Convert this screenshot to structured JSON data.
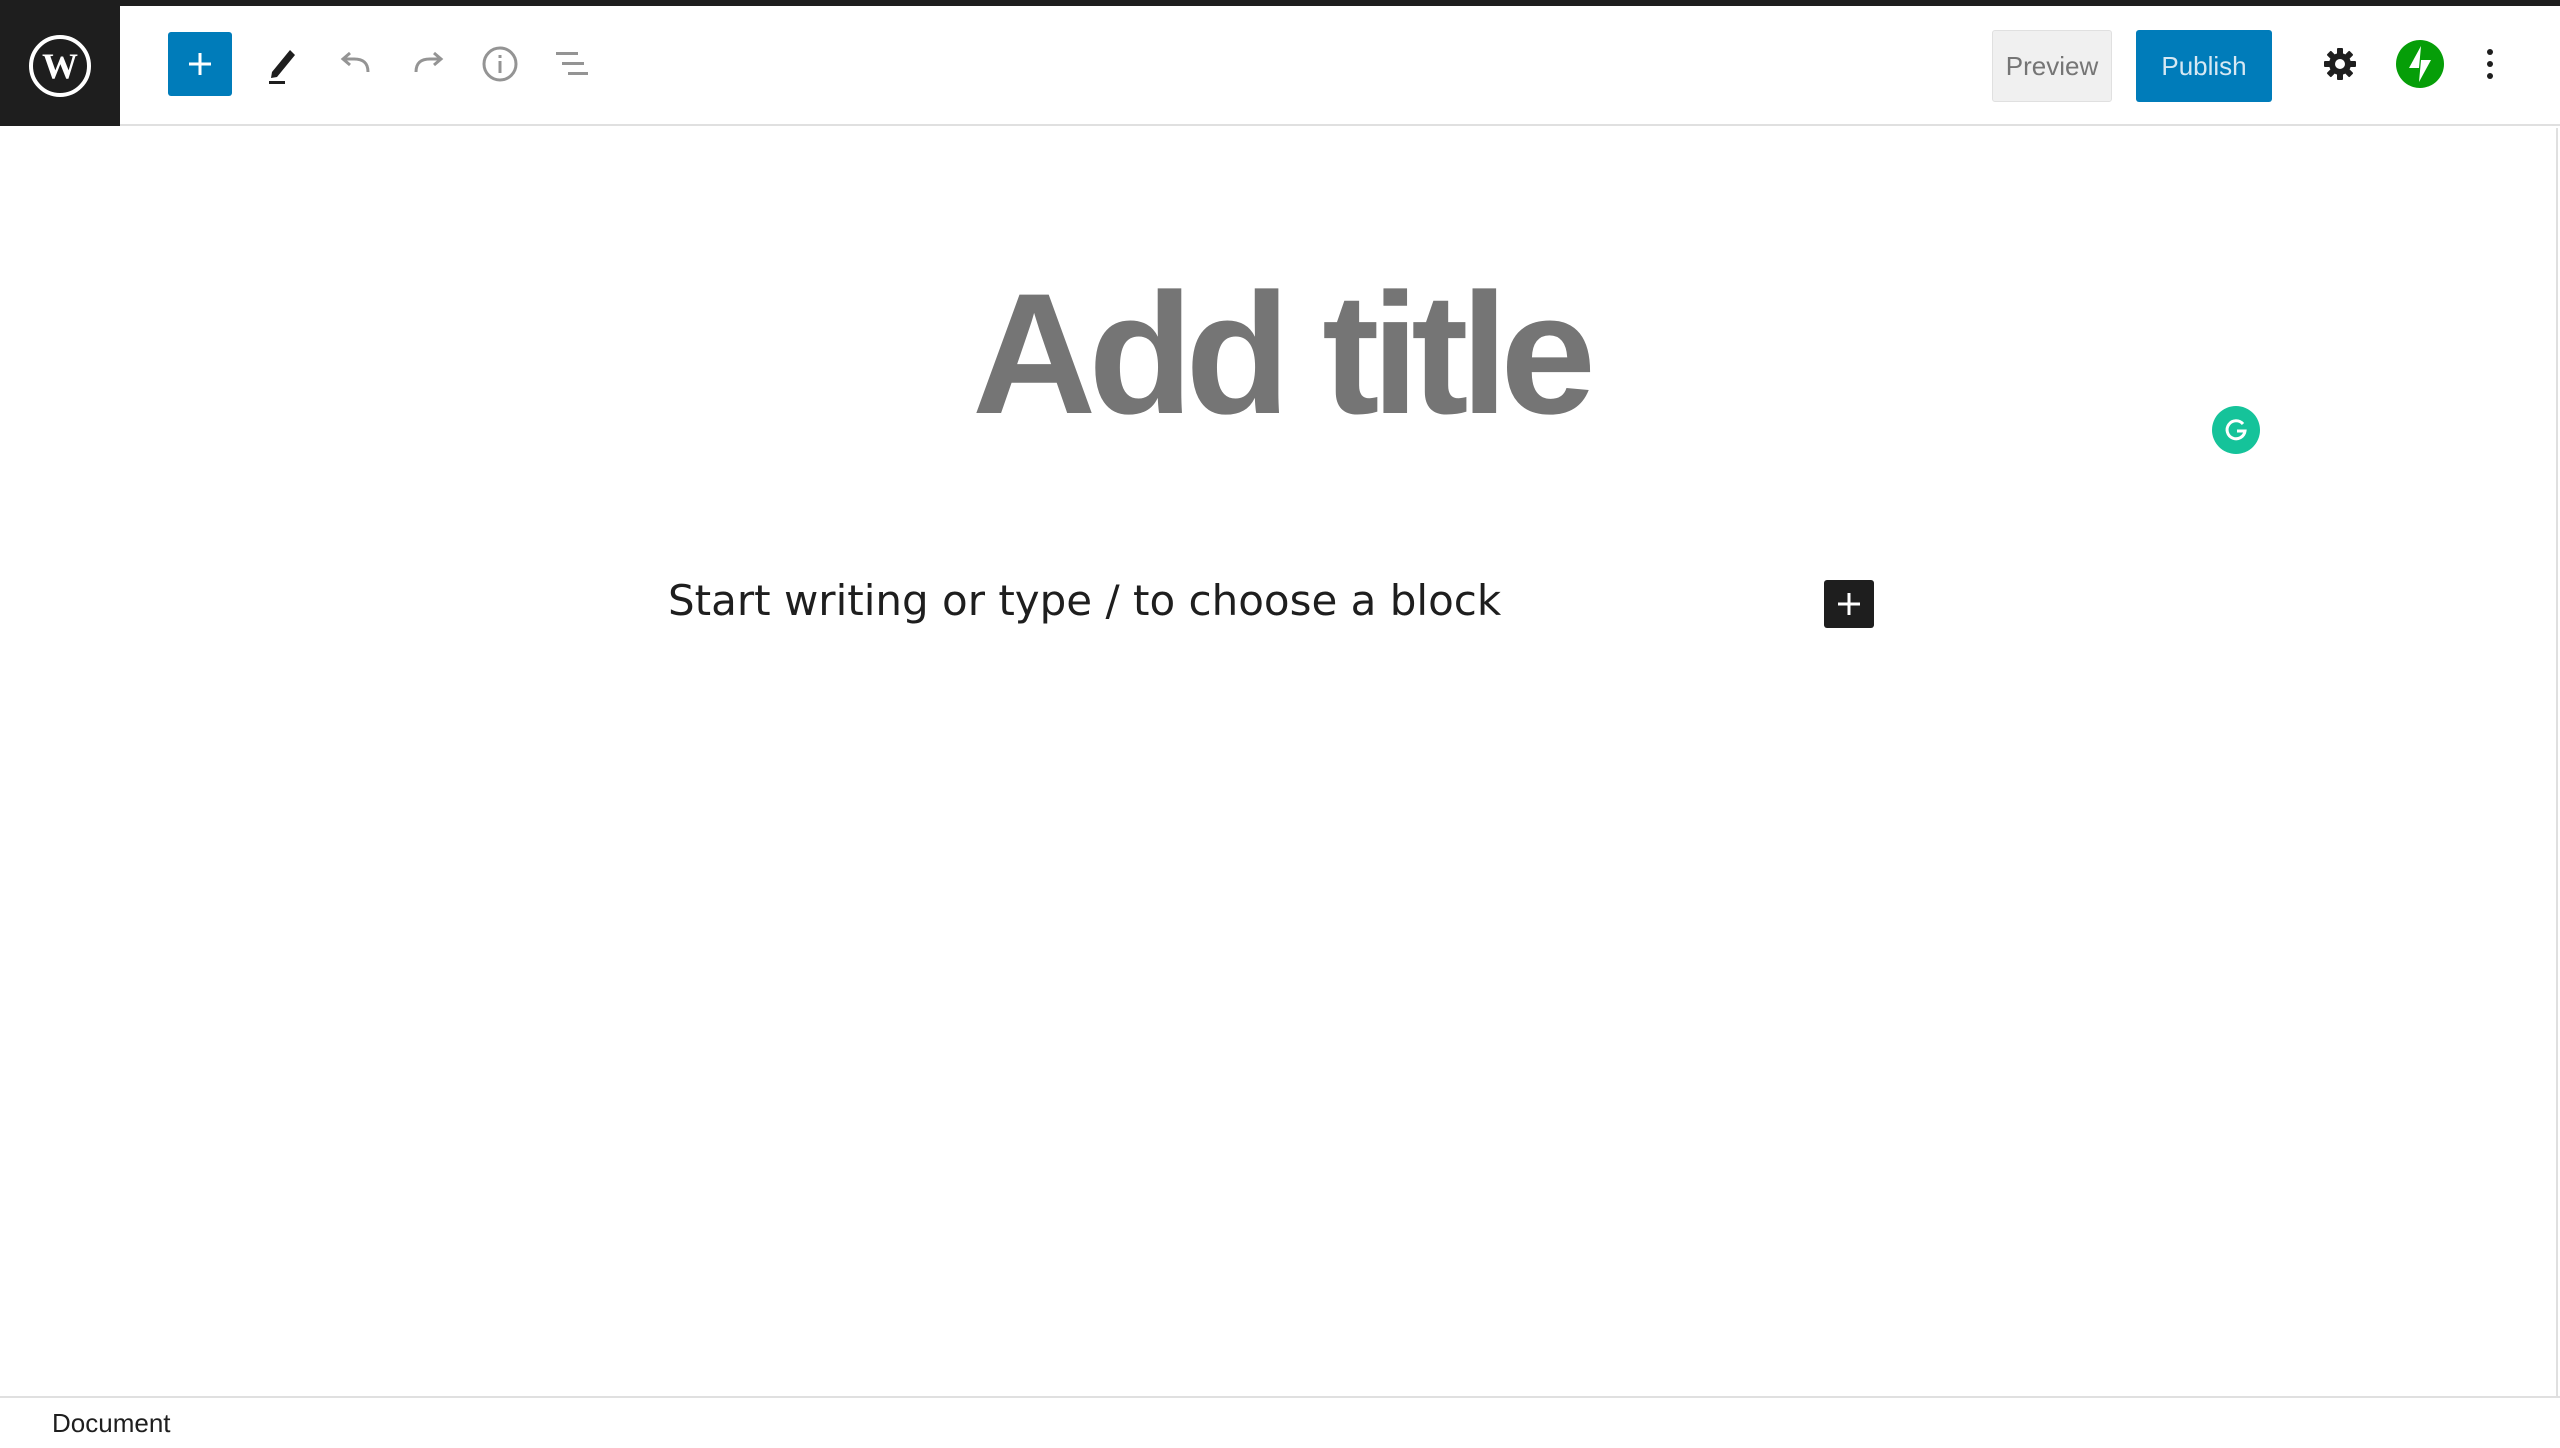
{
  "header": {
    "add_block_icon": "plus-icon",
    "tools_icon": "pencil-icon",
    "undo_icon": "undo-icon",
    "redo_icon": "redo-icon",
    "info_icon": "info-icon",
    "outline_icon": "list-view-icon",
    "preview_label": "Preview",
    "publish_label": "Publish",
    "settings_icon": "gear-icon",
    "jetpack_icon": "jetpack-bolt-icon",
    "more_icon": "more-vertical-icon"
  },
  "editor": {
    "title_placeholder": "Add title",
    "block_placeholder": "Start writing or type / to choose a block",
    "inline_inserter_icon": "plus-icon",
    "grammarly_icon": "grammarly-icon"
  },
  "footer": {
    "breadcrumb": "Document"
  },
  "colors": {
    "accent": "#007cba",
    "dark": "#1e1e1e",
    "grammarly": "#15c39a",
    "jetpack": "#069e08",
    "title_placeholder": "#757575"
  }
}
